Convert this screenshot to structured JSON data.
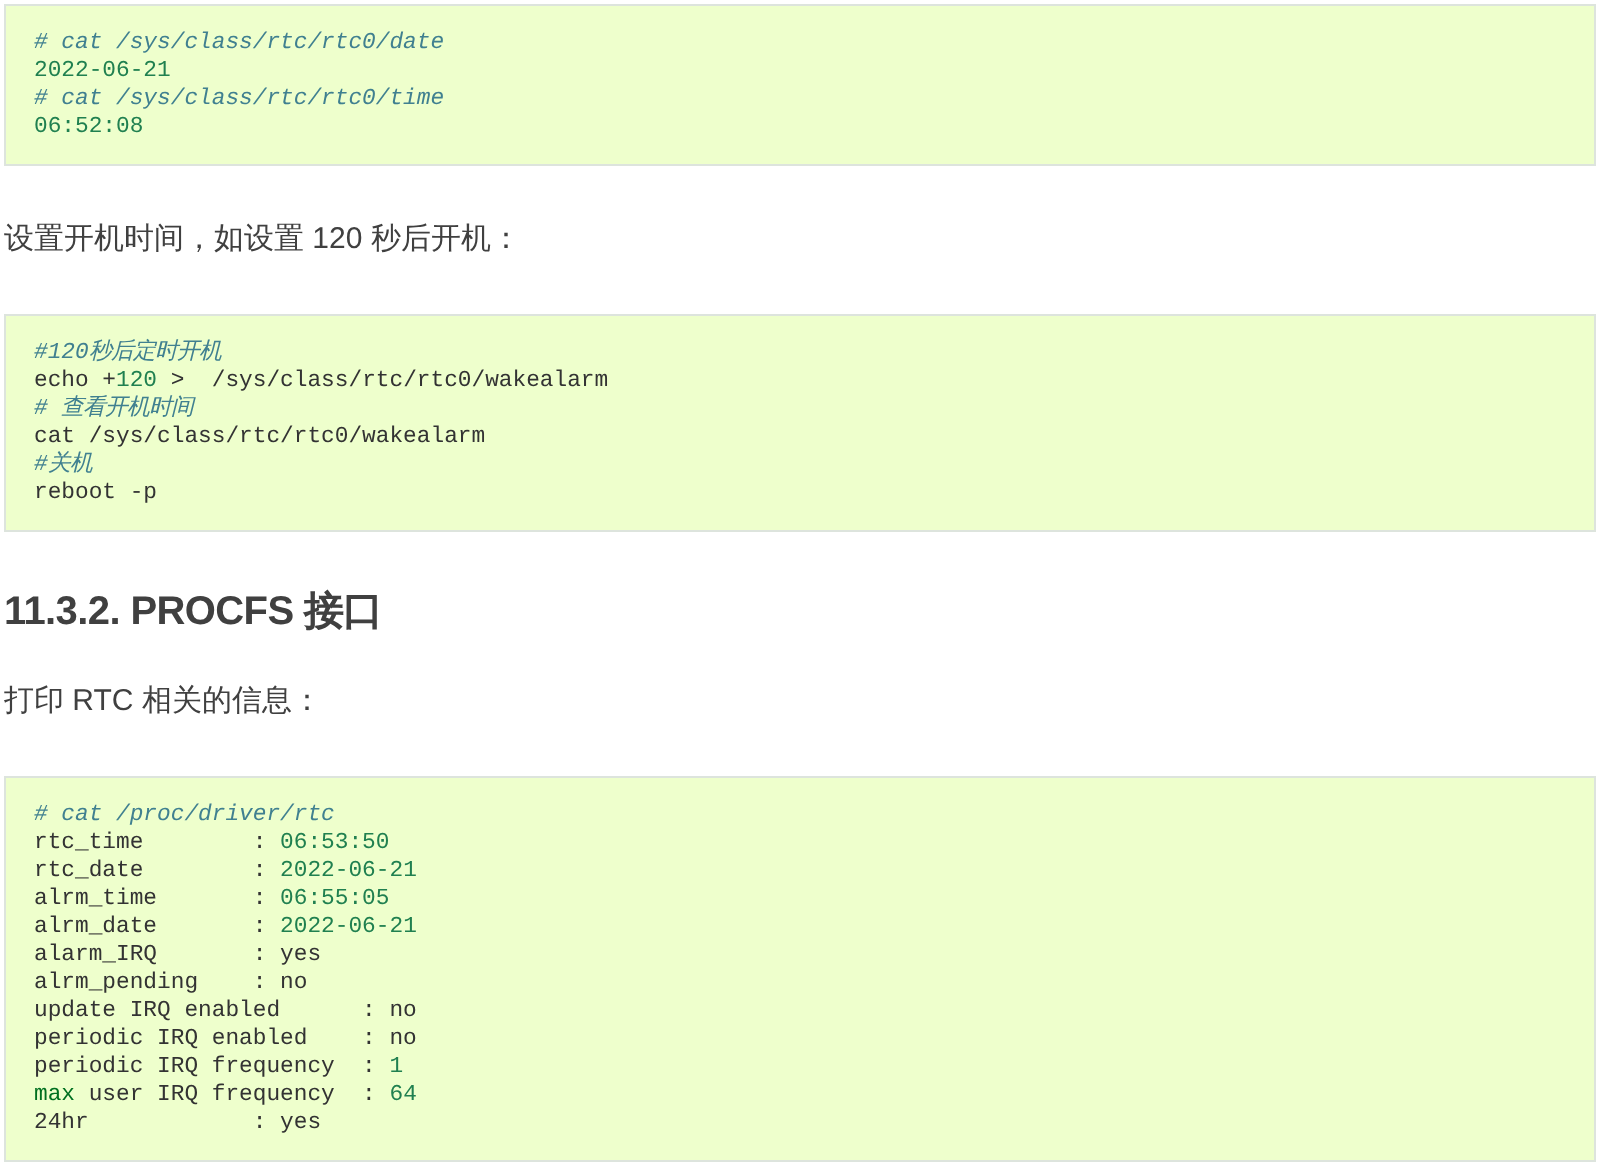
{
  "content": [
    {
      "kind": "code",
      "lines": [
        [
          {
            "kind": "comment",
            "text": "# cat /sys/class/rtc/rtc0/date"
          }
        ],
        [
          {
            "kind": "number",
            "text": "2022-06-21"
          }
        ],
        [
          {
            "kind": "comment",
            "text": "# cat /sys/class/rtc/rtc0/time"
          }
        ],
        [
          {
            "kind": "number",
            "text": "06:52:08"
          }
        ]
      ]
    },
    {
      "kind": "paragraph",
      "text": "设置开机时间，如设置 120 秒后开机："
    },
    {
      "kind": "code",
      "lines": [
        [
          {
            "kind": "comment",
            "text": "#120秒后定时开机"
          }
        ],
        [
          {
            "kind": "plain",
            "text": "echo +"
          },
          {
            "kind": "number",
            "text": "120"
          },
          {
            "kind": "plain",
            "text": " >  /sys/class/rtc/rtc0/wakealarm"
          }
        ],
        [
          {
            "kind": "comment",
            "text": "# 查看开机时间"
          }
        ],
        [
          {
            "kind": "plain",
            "text": "cat /sys/class/rtc/rtc0/wakealarm"
          }
        ],
        [
          {
            "kind": "comment",
            "text": "#关机"
          }
        ],
        [
          {
            "kind": "plain",
            "text": "reboot -p"
          }
        ]
      ]
    },
    {
      "kind": "heading",
      "text": "11.3.2. PROCFS 接口"
    },
    {
      "kind": "paragraph",
      "text": "打印 RTC 相关的信息："
    },
    {
      "kind": "code",
      "lines": [
        [
          {
            "kind": "comment",
            "text": "# cat /proc/driver/rtc"
          }
        ],
        [
          {
            "kind": "plain",
            "text": "rtc_time        : "
          },
          {
            "kind": "number",
            "text": "06:53:50"
          }
        ],
        [
          {
            "kind": "plain",
            "text": "rtc_date        : "
          },
          {
            "kind": "number",
            "text": "2022-06-21"
          }
        ],
        [
          {
            "kind": "plain",
            "text": "alrm_time       : "
          },
          {
            "kind": "number",
            "text": "06:55:05"
          }
        ],
        [
          {
            "kind": "plain",
            "text": "alrm_date       : "
          },
          {
            "kind": "number",
            "text": "2022-06-21"
          }
        ],
        [
          {
            "kind": "plain",
            "text": "alarm_IRQ       : yes"
          }
        ],
        [
          {
            "kind": "plain",
            "text": "alrm_pending    : no"
          }
        ],
        [
          {
            "kind": "plain",
            "text": "update IRQ enabled      : no"
          }
        ],
        [
          {
            "kind": "plain",
            "text": "periodic IRQ enabled    : no"
          }
        ],
        [
          {
            "kind": "plain",
            "text": "periodic IRQ frequency  : "
          },
          {
            "kind": "number",
            "text": "1"
          }
        ],
        [
          {
            "kind": "builtin",
            "text": "max"
          },
          {
            "kind": "plain",
            "text": " user IRQ frequency  : "
          },
          {
            "kind": "number",
            "text": "64"
          }
        ],
        [
          {
            "kind": "plain",
            "text": "24hr            : yes"
          }
        ]
      ]
    }
  ]
}
